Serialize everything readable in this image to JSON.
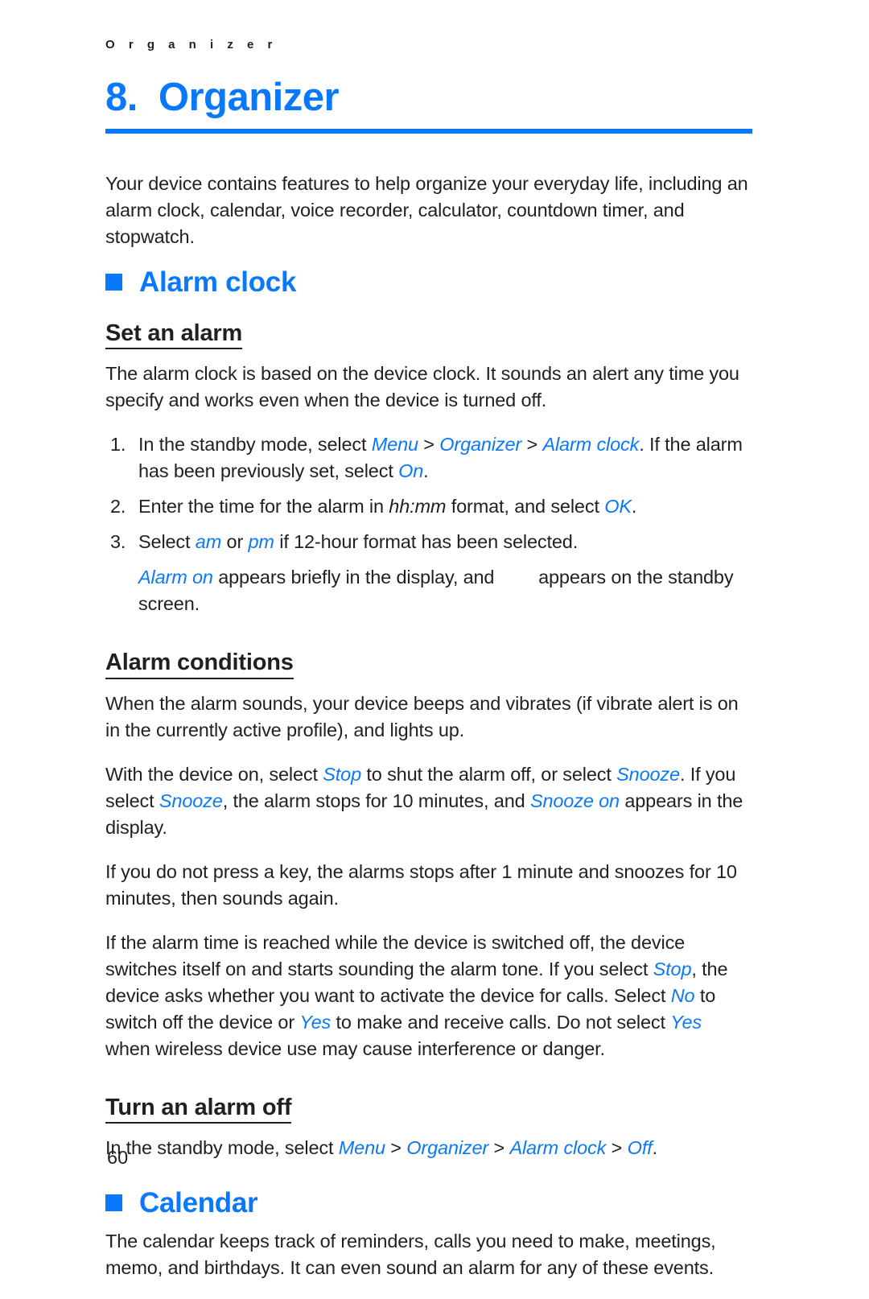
{
  "colors": {
    "accent_blue": "#0a78fa",
    "text_black": "#231f20",
    "page_background": "#ffffff"
  },
  "running_header": "O r g a n i z e r",
  "chapter": {
    "number": "8.",
    "title": "Organizer"
  },
  "intro_paragraph": "Your device contains features to help organize your everyday life, including an alarm clock, calendar, voice recorder, calculator, countdown timer, and stopwatch.",
  "sections": [
    {
      "heading": "Alarm clock",
      "bullet": "square-bullet",
      "subsections": [
        {
          "heading": "Set an alarm",
          "intro": "The alarm clock is based on the device clock. It sounds an alert any time you specify and works even when the device is turned off.",
          "steps": [
            {
              "number": "1.",
              "text_1": "In the standby mode, select ",
              "ui_1": "Menu",
              "sep_1": " > ",
              "ui_2": "Organizer",
              "sep_2": " > ",
              "ui_3": "Alarm clock",
              "text_2": ". If the alarm has been previously set, select ",
              "ui_4": "On",
              "text_3": "."
            },
            {
              "number": "2.",
              "text_1": "Enter the time for the alarm in ",
              "em_1": "hh:mm",
              "text_2": " format, and select ",
              "ui_1": "OK",
              "text_3": "."
            },
            {
              "number": "3.",
              "text_1": "Select ",
              "ui_1": "am",
              "text_2": " or ",
              "ui_2": "pm",
              "text_3": " if 12-hour format has been selected."
            }
          ],
          "note": {
            "ui_1": "Alarm on",
            "text_1": " appears briefly in the display, and ",
            "icon": "alarm-indicator-icon",
            "text_2": " appears on the standby screen."
          }
        },
        {
          "heading": "Alarm conditions",
          "paragraphs": [
            {
              "text_1": "When the alarm sounds, your device beeps and vibrates (if vibrate alert is on in the currently active profile), and lights up."
            },
            {
              "text_1": "With the device on, select ",
              "ui_1": "Stop",
              "text_2": " to shut the alarm off, or select ",
              "ui_2": "Snooze",
              "text_3": ". If you select ",
              "ui_3": "Snooze",
              "text_4": ", the alarm stops for 10 minutes, and ",
              "ui_4": "Snooze on",
              "text_5": " appears in the display."
            },
            {
              "text_1": "If you do not press a key, the alarms stops after 1 minute and snoozes for 10 minutes, then sounds again."
            },
            {
              "text_1": "If the alarm time is reached while the device is switched off, the device switches itself on and starts sounding the alarm tone. If you select ",
              "ui_1": "Stop",
              "text_2": ", the device asks whether you want to activate the device for calls. Select ",
              "ui_2": "No",
              "text_3": " to switch off the device or ",
              "ui_3": "Yes",
              "text_4": " to make and receive calls. Do not select ",
              "ui_4": "Yes",
              "text_5": " when wireless device use may cause interference or danger."
            }
          ]
        },
        {
          "heading": "Turn an alarm off",
          "paragraph": {
            "text_1": "In the standby mode, select ",
            "ui_1": "Menu",
            "sep_1": " > ",
            "ui_2": "Organizer",
            "sep_2": " > ",
            "ui_3": "Alarm clock",
            "sep_3": " > ",
            "ui_4": "Off",
            "text_2": "."
          }
        }
      ]
    },
    {
      "heading": "Calendar",
      "bullet": "square-bullet",
      "paragraph": "The calendar keeps track of reminders, calls you need to make, meetings, memo, and birthdays. It can even sound an alarm for any of these events."
    }
  ],
  "page_number": "60"
}
